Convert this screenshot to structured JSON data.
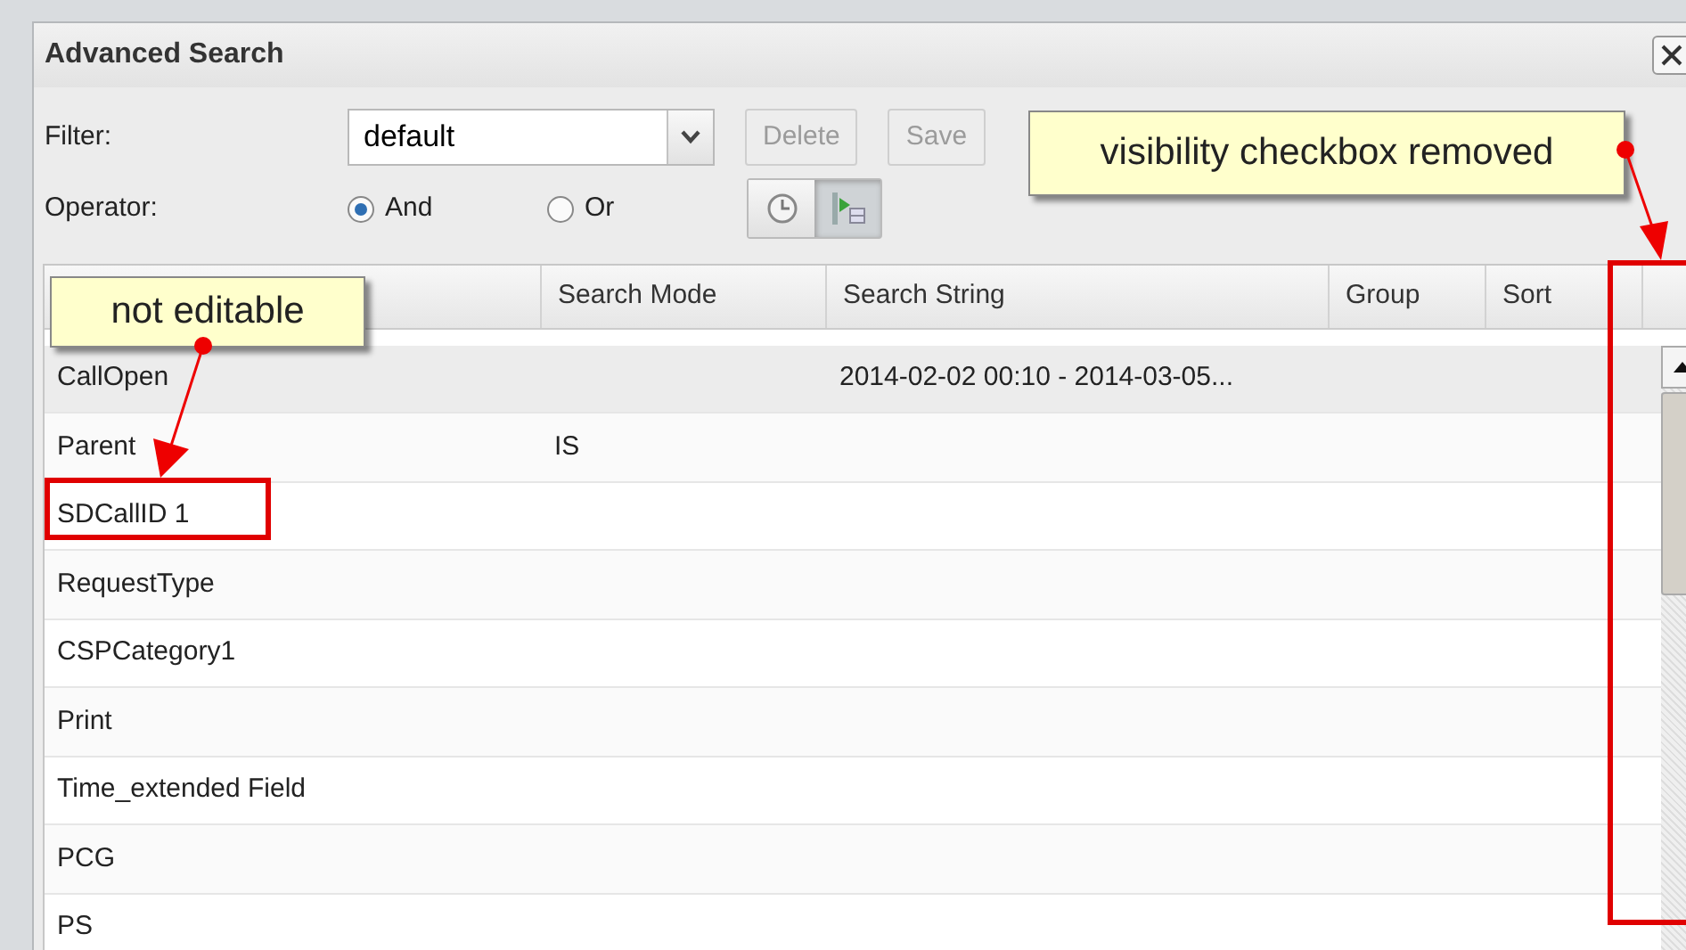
{
  "window": {
    "title": "Advanced Search"
  },
  "filter": {
    "label": "Filter:",
    "value": "default"
  },
  "buttons": [
    {
      "label": "Delete",
      "disabled": true
    },
    {
      "label": "Save",
      "disabled": true
    }
  ],
  "operator": {
    "label": "Operator:",
    "options": [
      {
        "label": "And",
        "selected": true
      },
      {
        "label": "Or",
        "selected": false
      }
    ]
  },
  "view_toggles": [
    {
      "kind": "clock",
      "selected": false
    },
    {
      "kind": "play",
      "selected": true
    }
  ],
  "table": {
    "columns": [
      "Search Mode",
      "Search String",
      "Group",
      "Sort"
    ],
    "rows": [
      {
        "label": "CallOpen",
        "search_string": "2014-02-02 00:10 - 2014-03-05...",
        "selected": true
      },
      {
        "label": "Parent",
        "search_mode": "IS",
        "selected": false
      },
      {
        "label": "SDCallID 1",
        "selected": false
      },
      {
        "label": "RequestType",
        "selected": false
      },
      {
        "label": "CSPCategory1",
        "selected": false
      },
      {
        "label": "Print",
        "selected": false
      },
      {
        "label": "Time_extended Field",
        "selected": false
      },
      {
        "label": "PCG",
        "selected": false
      },
      {
        "label": "PS",
        "selected": false
      }
    ]
  },
  "annotations": [
    {
      "text": "visibility checkbox removed"
    },
    {
      "text": "not editable"
    }
  ]
}
